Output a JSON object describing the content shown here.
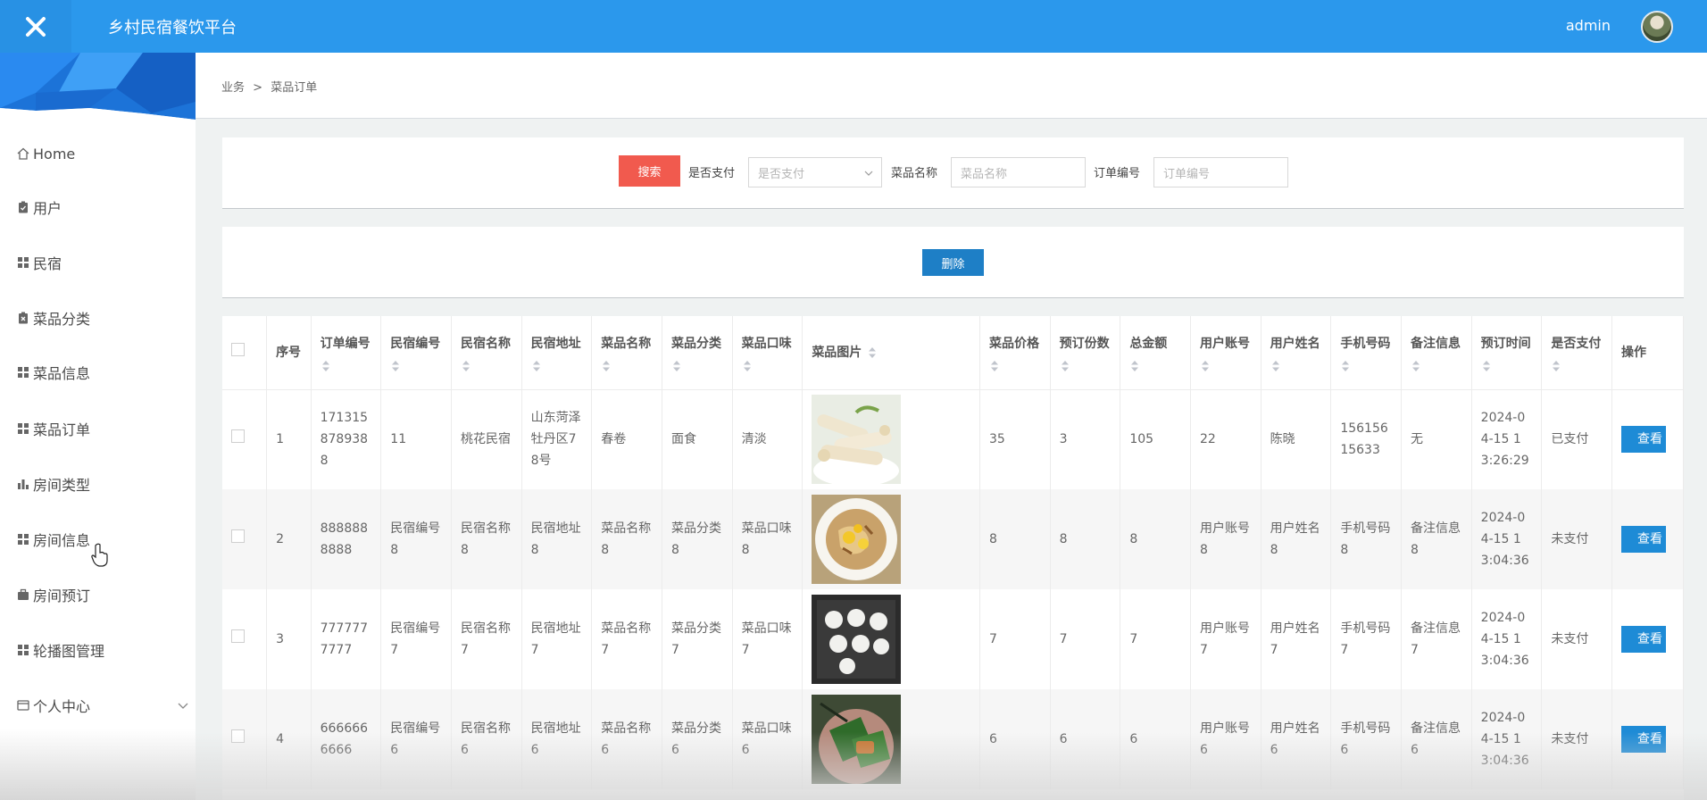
{
  "header": {
    "close_icon": "close-icon",
    "title": "乡村民宿餐饮平台",
    "user": "admin"
  },
  "sidebar": {
    "items": [
      {
        "label": "Home",
        "icon": "home-icon"
      },
      {
        "label": "用户",
        "icon": "clipboard-icon"
      },
      {
        "label": "民宿",
        "icon": "grid-icon"
      },
      {
        "label": "菜品分类",
        "icon": "clipboard-x-icon"
      },
      {
        "label": "菜品信息",
        "icon": "grid-icon"
      },
      {
        "label": "菜品订单",
        "icon": "grid-icon"
      },
      {
        "label": "房间类型",
        "icon": "bar-chart-icon"
      },
      {
        "label": "房间信息",
        "icon": "grid-icon"
      },
      {
        "label": "房间预订",
        "icon": "briefcase-icon"
      },
      {
        "label": "轮播图管理",
        "icon": "grid-icon"
      },
      {
        "label": "个人中心",
        "icon": "card-icon"
      }
    ]
  },
  "breadcrumb": {
    "root": "业务",
    "sep": ">",
    "current": "菜品订单"
  },
  "search": {
    "button": "搜索",
    "paid_label": "是否支付",
    "paid_placeholder": "是否支付",
    "dish_label": "菜品名称",
    "dish_placeholder": "菜品名称",
    "order_label": "订单编号",
    "order_placeholder": "订单编号"
  },
  "actions": {
    "delete": "删除"
  },
  "table": {
    "headers": {
      "seq": "序号",
      "order_no": "订单编号",
      "homestay_no": "民宿编号",
      "homestay_name": "民宿名称",
      "homestay_addr": "民宿地址",
      "dish_name": "菜品名称",
      "dish_cat": "菜品分类",
      "dish_taste": "菜品口味",
      "dish_img": "菜品图片",
      "price": "菜品价格",
      "qty": "预订份数",
      "total": "总金额",
      "user_acct": "用户账号",
      "user_name": "用户姓名",
      "phone": "手机号码",
      "remark": "备注信息",
      "order_time": "预订时间",
      "paid": "是否支付",
      "op": "操作"
    },
    "view_label": "查看",
    "rows": [
      {
        "seq": "1",
        "order_no": "1713158789388",
        "homestay_no": "11",
        "homestay_name": "桃花民宿",
        "homestay_addr": "山东菏泽牡丹区78号",
        "dish_name": "春卷",
        "dish_cat": "面食",
        "dish_taste": "清淡",
        "img": "spring-rolls",
        "price": "35",
        "qty": "3",
        "total": "105",
        "user_acct": "22",
        "user_name": "陈晓",
        "phone": "15615615633",
        "remark": "无",
        "order_time": "2024-04-15 13:26:29",
        "paid": "已支付"
      },
      {
        "seq": "2",
        "order_no": "8888888888",
        "homestay_no": "民宿编号8",
        "homestay_name": "民宿名称8",
        "homestay_addr": "民宿地址8",
        "dish_name": "菜品名称8",
        "dish_cat": "菜品分类8",
        "dish_taste": "菜品口味8",
        "img": "egg-stirfry",
        "price": "8",
        "qty": "8",
        "total": "8",
        "user_acct": "用户账号8",
        "user_name": "用户姓名8",
        "phone": "手机号码8",
        "remark": "备注信息8",
        "order_time": "2024-04-15 13:04:36",
        "paid": "未支付"
      },
      {
        "seq": "3",
        "order_no": "7777777777",
        "homestay_no": "民宿编号7",
        "homestay_name": "民宿名称7",
        "homestay_addr": "民宿地址7",
        "dish_name": "菜品名称7",
        "dish_cat": "菜品分类7",
        "dish_taste": "菜品口味7",
        "img": "dumplings",
        "price": "7",
        "qty": "7",
        "total": "7",
        "user_acct": "用户账号7",
        "user_name": "用户姓名7",
        "phone": "手机号码7",
        "remark": "备注信息7",
        "order_time": "2024-04-15 13:04:36",
        "paid": "未支付"
      },
      {
        "seq": "4",
        "order_no": "6666666666",
        "homestay_no": "民宿编号6",
        "homestay_name": "民宿名称6",
        "homestay_addr": "民宿地址6",
        "dish_name": "菜品名称6",
        "dish_cat": "菜品分类6",
        "dish_taste": "菜品口味6",
        "img": "leaf-wraps",
        "price": "6",
        "qty": "6",
        "total": "6",
        "user_acct": "用户账号6",
        "user_name": "用户姓名6",
        "phone": "手机号码6",
        "remark": "备注信息6",
        "order_time": "2024-04-15 13:04:36",
        "paid": "未支付"
      }
    ]
  },
  "colors": {
    "header_bg": "#2b98ec",
    "search_btn": "#f15a4e",
    "action_btn": "#1e7fc6"
  }
}
